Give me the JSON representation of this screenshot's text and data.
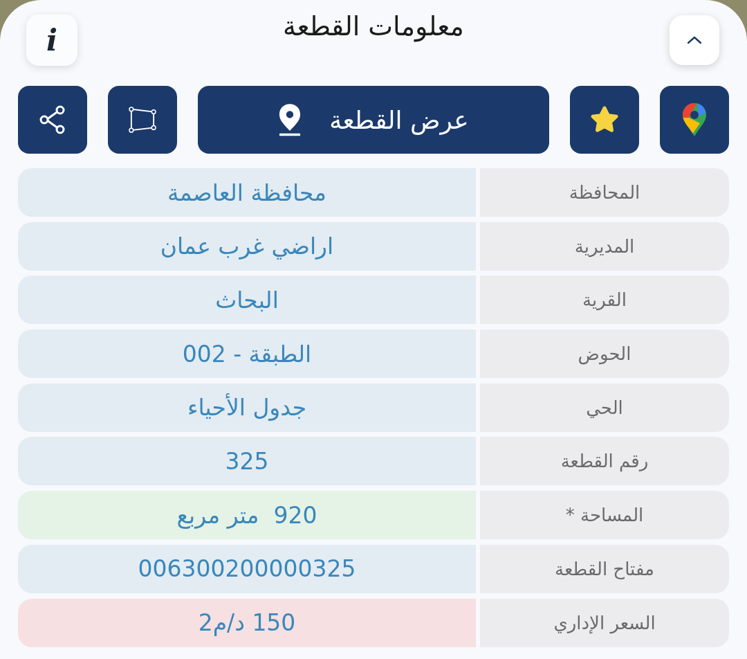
{
  "title": "معلومات القطعة",
  "info_button": {
    "label": "i"
  },
  "actions": [
    {
      "kind": "maps"
    },
    {
      "kind": "favorite"
    },
    {
      "kind": "show",
      "label": "عرض القطعة"
    },
    {
      "kind": "polygon"
    },
    {
      "kind": "share"
    }
  ],
  "rows": [
    {
      "label": "المحافظة",
      "value": "محافظة العاصمة",
      "color": "#e3ecf2"
    },
    {
      "label": "المديرية",
      "value": "اراضي غرب عمان",
      "color": "#e3ecf2"
    },
    {
      "label": "القرية",
      "value": "البحاث",
      "color": "#e3ecf2"
    },
    {
      "label": "الحوض",
      "value": "الطبقة - 002",
      "color": "#e3ecf2"
    },
    {
      "label": "الحي",
      "value": "جدول الأحياء",
      "color": "#e3ecf2"
    },
    {
      "label": "رقم القطعة",
      "value": "325",
      "color": "#e3ecf2"
    },
    {
      "label": "المساحة *",
      "value": "920  متر مربع",
      "color": "#e4f3e6"
    },
    {
      "label": "مفتاح القطعة",
      "value": "006300200000325",
      "color": "#e3ecf2"
    },
    {
      "label": "السعر الإداري",
      "value": "150 د/م2",
      "color": "#f6e0e1"
    }
  ]
}
